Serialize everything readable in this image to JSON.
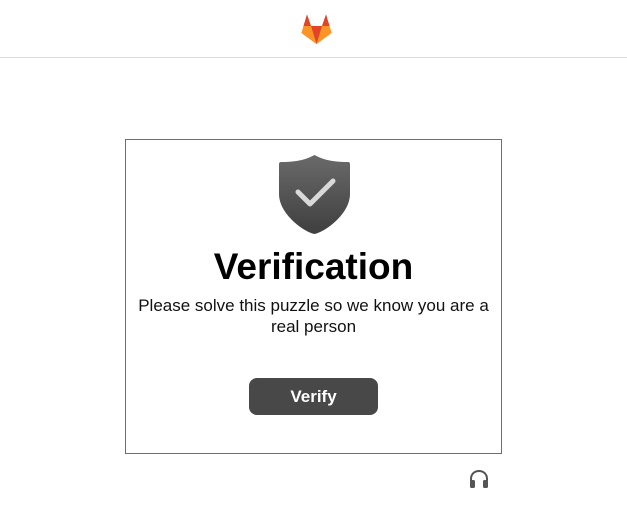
{
  "header": {
    "logo_icon": "gitlab-fox-icon",
    "colors": {
      "logo_orange": "#e24329",
      "logo_light": "#fca326",
      "logo_mid": "#fc6d26"
    }
  },
  "verification": {
    "icon": "shield-check-icon",
    "title": "Verification",
    "message": "Please solve this puzzle so we know you are a real person",
    "button_label": "Verify",
    "colors": {
      "button_bg": "#484848",
      "shield": "#555555",
      "border": "#6e6e6e"
    }
  },
  "footer": {
    "audio_icon": "headphones-icon"
  }
}
